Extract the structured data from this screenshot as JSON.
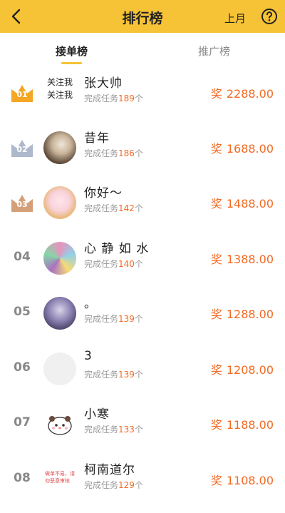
{
  "header": {
    "title": "排行榜",
    "period_label": "上月",
    "back_icon": "chevron-left-icon",
    "help_icon": "question-circle-icon",
    "bg_color": "#F6C336"
  },
  "tabs": [
    {
      "label": "接单榜",
      "active": true
    },
    {
      "label": "推广榜",
      "active": false
    }
  ],
  "accent_color": "#F26A23",
  "rows": [
    {
      "rank": "01",
      "badge": "gold-crown",
      "avatar_text_1": "关注我",
      "avatar_text_2": "关注我",
      "name": "张大帅",
      "task_prefix": "完成任务",
      "task_count": "189",
      "task_suffix": "个",
      "reward_label": "奖",
      "reward": "2288.00"
    },
    {
      "rank": "02",
      "badge": "silver-crown",
      "name": "昔年",
      "task_prefix": "完成任务",
      "task_count": "186",
      "task_suffix": "个",
      "reward_label": "奖",
      "reward": "1688.00"
    },
    {
      "rank": "03",
      "badge": "bronze-crown",
      "name": "你好～",
      "task_prefix": "完成任务",
      "task_count": "142",
      "task_suffix": "个",
      "reward_label": "奖",
      "reward": "1488.00"
    },
    {
      "rank": "04",
      "name": "心 静 如 水",
      "task_prefix": "完成任务",
      "task_count": "140",
      "task_suffix": "个",
      "reward_label": "奖",
      "reward": "1388.00"
    },
    {
      "rank": "05",
      "name": "。",
      "task_prefix": "完成任务",
      "task_count": "139",
      "task_suffix": "个",
      "reward_label": "奖",
      "reward": "1288.00"
    },
    {
      "rank": "06",
      "name": "3",
      "task_prefix": "完成任务",
      "task_count": "139",
      "task_suffix": "个",
      "reward_label": "奖",
      "reward": "1208.00"
    },
    {
      "rank": "07",
      "name": "小寒",
      "task_prefix": "完成任务",
      "task_count": "133",
      "task_suffix": "个",
      "reward_label": "奖",
      "reward": "1188.00"
    },
    {
      "rank": "08",
      "avatar_small_text": "做单不易，请勿恶意审核",
      "name": "柯南道尔",
      "task_prefix": "完成任务",
      "task_count": "129",
      "task_suffix": "个",
      "reward_label": "奖",
      "reward": "1108.00"
    }
  ]
}
